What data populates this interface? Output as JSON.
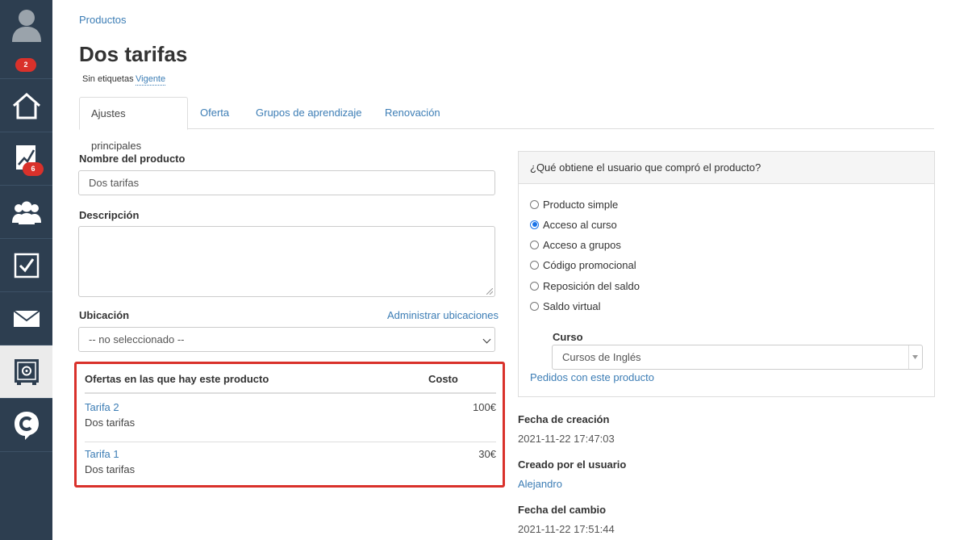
{
  "sidebar": {
    "badges": {
      "profile": "2",
      "stats": "6"
    }
  },
  "breadcrumb": "Productos",
  "title": "Dos tarifas",
  "tags_text": "Sin etiquetas",
  "status": "Vigente",
  "tabs": [
    {
      "label": "Ajustes principales"
    },
    {
      "label": "Oferta"
    },
    {
      "label": "Grupos de aprendizaje"
    },
    {
      "label": "Renovación"
    }
  ],
  "form": {
    "name_label": "Nombre del producto",
    "name_value": "Dos tarifas",
    "description_label": "Descripción",
    "location_label": "Ubicación",
    "manage_locations": "Administrar ubicaciones",
    "location_value": "-- no seleccionado --"
  },
  "offers": {
    "col_offers": "Ofertas en las que hay este producto",
    "col_cost": "Costo",
    "rows": [
      {
        "name": "Tarifa 2",
        "product": "Dos tarifas",
        "cost": "100€"
      },
      {
        "name": "Tarifa 1",
        "product": "Dos tarifas",
        "cost": "30€"
      }
    ]
  },
  "panel": {
    "title": "¿Qué obtiene el usuario que compró el producto?",
    "options": [
      {
        "label": "Producto simple",
        "checked": false
      },
      {
        "label": "Acceso al curso",
        "checked": true
      },
      {
        "label": "Acceso a grupos",
        "checked": false
      },
      {
        "label": "Código promocional",
        "checked": false
      },
      {
        "label": "Reposición del saldo",
        "checked": false
      },
      {
        "label": "Saldo virtual",
        "checked": false
      }
    ],
    "course_label": "Curso",
    "course_value": "Cursos de Inglés",
    "orders_link": "Pedidos con este producto"
  },
  "meta": {
    "created_label": "Fecha de creación",
    "created_value": "2021-11-22 17:47:03",
    "created_by_label": "Creado por el usuario",
    "created_by_value": "Alejandro",
    "changed_label": "Fecha del cambio",
    "changed_value": "2021-11-22 17:51:44"
  },
  "colors": {
    "sidebar": "#2d3e50",
    "link": "#3c7db5",
    "badge": "#d9312b",
    "highlight": "#d9312b"
  }
}
